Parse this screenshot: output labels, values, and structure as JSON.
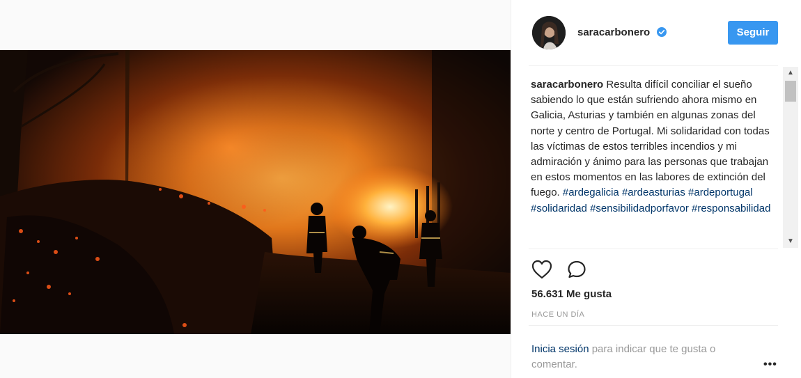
{
  "post": {
    "username": "saracarbonero",
    "follow_label": "Seguir",
    "caption_text": "Resulta difícil conciliar el sueño sabiendo lo que están sufriendo ahora mismo en Galicia, Asturias y también en algunas zonas del norte y centro de Portugal. Mi solidaridad con todas las víctimas de estos terribles incendios y mi admiración y ánimo para las personas que trabajan en estos momentos en las labores de extinción del fuego.",
    "hashtags": [
      "#ardegalicia",
      "#ardeasturias",
      "#ardeportugal",
      "#solidaridad",
      "#sensibilidadporfavor",
      "#responsabilidad"
    ],
    "likes_text": "56.631 Me gusta",
    "timestamp": "HACE UN DÍA",
    "login_link": "Inicia sesión",
    "login_rest": "para indicar que te gusta o comentar.",
    "more_label": "•••"
  },
  "scrollbar": {
    "up": "▲",
    "down": "▼"
  },
  "colors": {
    "accent": "#3897f0",
    "link": "#003569",
    "muted": "#999999",
    "text": "#262626"
  },
  "icons": {
    "verified": "verified-badge-icon",
    "like": "heart-icon",
    "comment": "comment-icon",
    "more": "more-options-icon"
  }
}
